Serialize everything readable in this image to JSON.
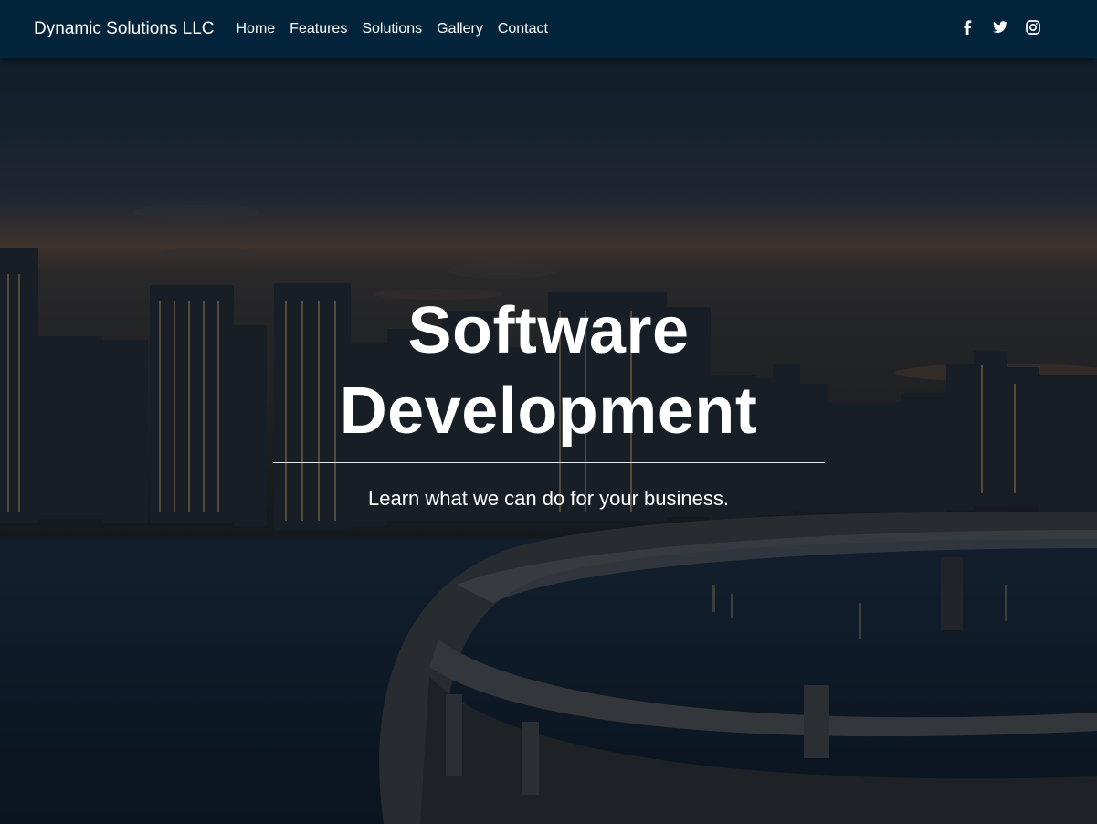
{
  "navbar": {
    "brand": "Dynamic Solutions LLC",
    "links": [
      {
        "label": "Home"
      },
      {
        "label": "Features"
      },
      {
        "label": "Solutions"
      },
      {
        "label": "Gallery"
      },
      {
        "label": "Contact"
      }
    ],
    "social": [
      {
        "icon": "facebook-icon"
      },
      {
        "icon": "twitter-icon"
      },
      {
        "icon": "instagram-icon"
      }
    ],
    "background_color": "#02263e"
  },
  "hero": {
    "title_line1": "Software",
    "title_line2": "Development",
    "subtitle": "Learn what we can do for your business.",
    "background_image": "city skyline at dusk with curved elevated highway over water"
  }
}
